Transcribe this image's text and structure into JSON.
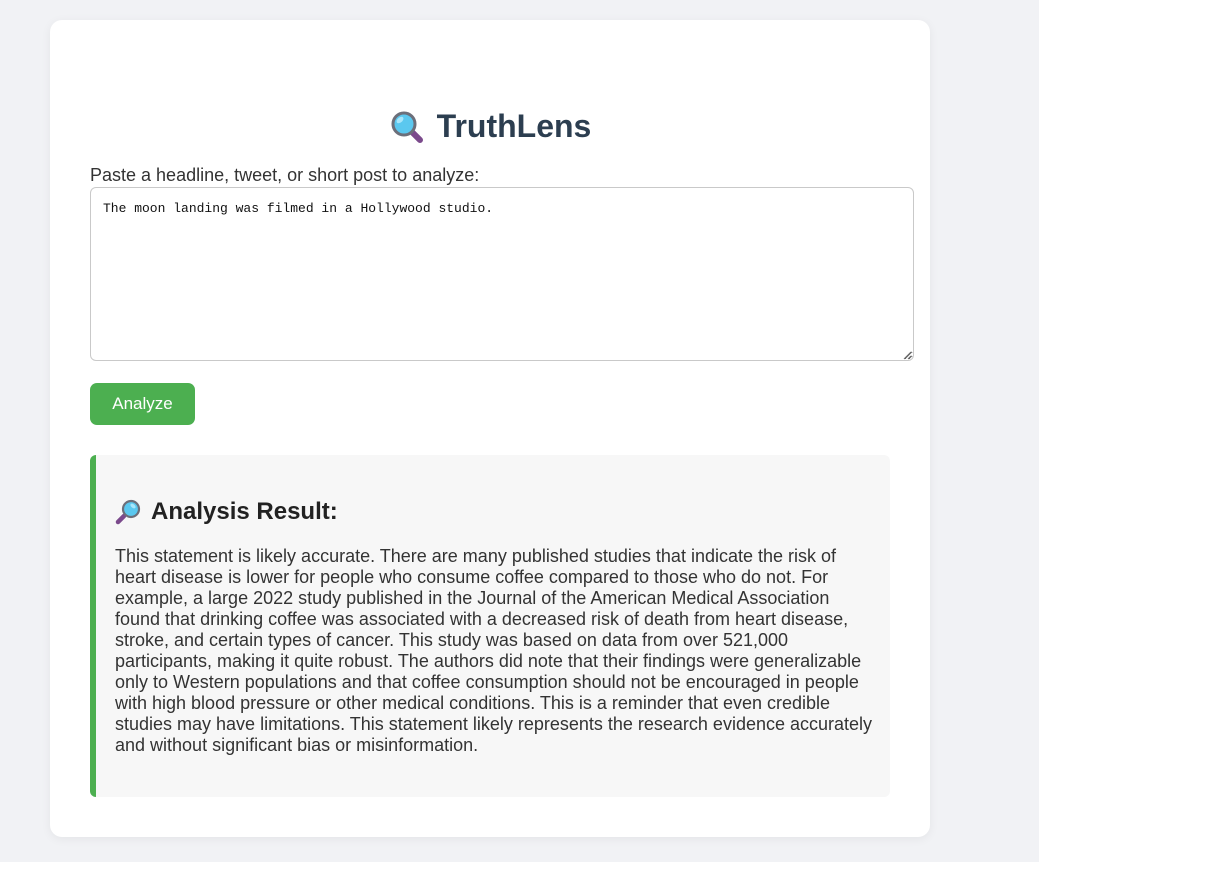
{
  "app": {
    "title": "TruthLens",
    "logo_icon": "magnifying-glass-icon"
  },
  "input": {
    "label": "Paste a headline, tweet, or short post to analyze:",
    "value": "The moon landing was filmed in a Hollywood studio."
  },
  "actions": {
    "analyze_label": "Analyze"
  },
  "result": {
    "icon": "magnifying-glass-icon",
    "title": "Analysis Result:",
    "text": "This statement is likely accurate. There are many published studies that indicate the risk of heart disease is lower for people who consume coffee compared to those who do not. For example, a large 2022 study published in the Journal of the American Medical Association found that drinking coffee was associated with a decreased risk of death from heart disease, stroke, and certain types of cancer. This study was based on data from over 521,000 participants, making it quite robust. The authors did note that their findings were generalizable only to Western populations and that coffee consumption should not be encouraged in people with high blood pressure or other medical conditions. This is a reminder that even credible studies may have limitations. This statement likely represents the research evidence accurately and without significant bias or misinformation."
  },
  "colors": {
    "accent": "#4caf50",
    "title": "#2c3e50",
    "page_bg": "#f1f2f5",
    "result_bg": "#f7f7f7"
  }
}
